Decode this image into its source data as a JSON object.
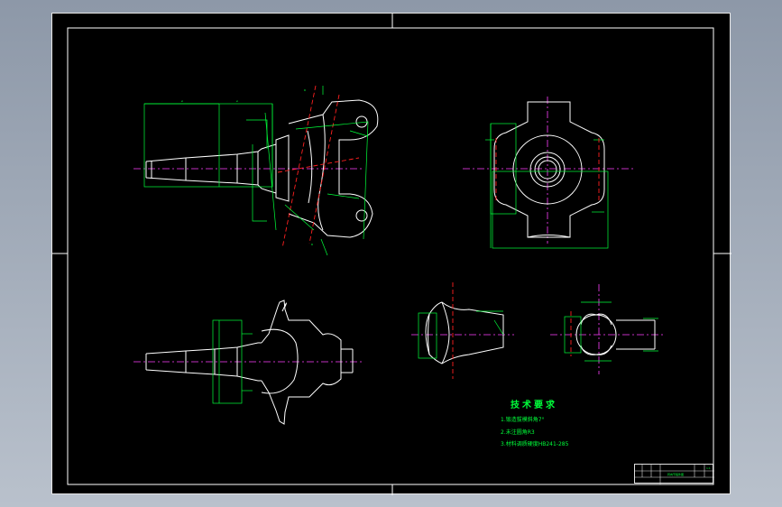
{
  "technical_requirements": {
    "title": "技术要求",
    "items": [
      "1.锻造拔模斜角7°",
      "2.未注圆角R3",
      "3.材料调质硬度HB241-285"
    ]
  },
  "title_block": {
    "drawing_name": "转向节锻件图",
    "scale": "1:1"
  },
  "colors": {
    "outline": "#ffffff",
    "dimension": "#00ff3a",
    "centerline": "#ff40ff",
    "section": "#ff2020",
    "background": "#000000"
  }
}
